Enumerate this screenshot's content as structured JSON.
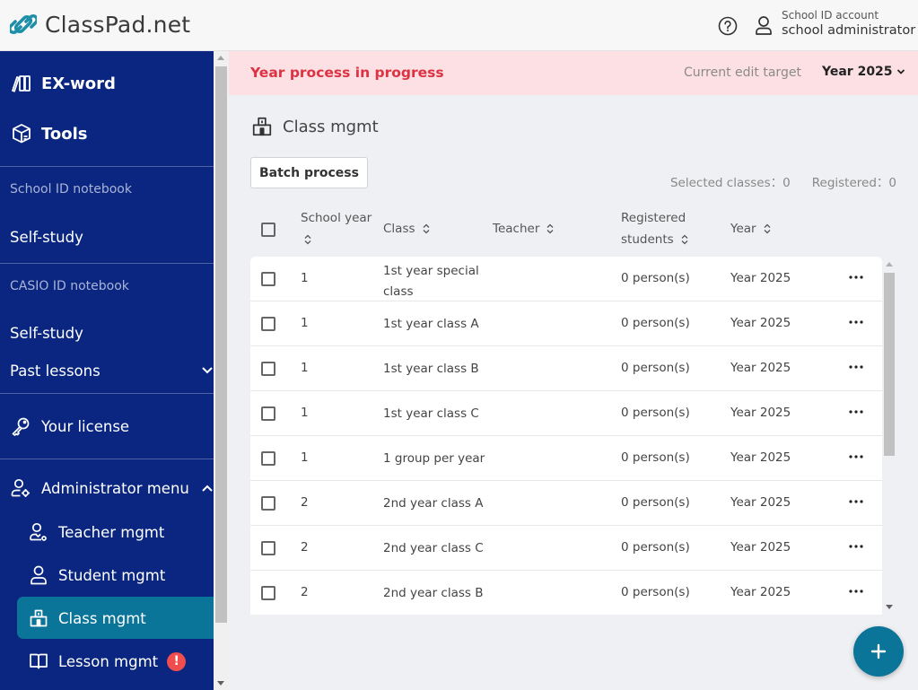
{
  "header": {
    "logo_text": "ClassPad.net",
    "account_type": "School ID account",
    "account_name": "school administrator"
  },
  "sidebar": {
    "exword": "EX-word",
    "tools": "Tools",
    "school_section": "School ID notebook",
    "school_selfstudy": "Self-study",
    "casio_section": "CASIO ID notebook",
    "casio_selfstudy": "Self-study",
    "past_lessons": "Past lessons",
    "license": "Your license",
    "admin_menu": "Administrator menu",
    "admin_items": [
      {
        "label": "Teacher mgmt"
      },
      {
        "label": "Student mgmt"
      },
      {
        "label": "Class mgmt",
        "active": true
      },
      {
        "label": "Lesson mgmt",
        "badge": "!"
      }
    ]
  },
  "banner": {
    "title": "Year process in progress",
    "edit_label": "Current edit target",
    "year": "Year 2025"
  },
  "page": {
    "title": "Class mgmt",
    "batch_button": "Batch process",
    "selected_classes": "Selected classes：0",
    "registered": "Registered：0"
  },
  "table": {
    "headers": {
      "school_year_1": "School year",
      "class": "Class",
      "teacher": "Teacher",
      "registered_1": "Registered",
      "registered_2": "students",
      "year": "Year"
    },
    "rows": [
      {
        "school_year": "1",
        "class": "1st year special class",
        "teacher": "",
        "registered": "0 person(s)",
        "year": "Year 2025"
      },
      {
        "school_year": "1",
        "class": "1st year class A",
        "teacher": "",
        "registered": "0 person(s)",
        "year": "Year 2025"
      },
      {
        "school_year": "1",
        "class": "1st year class B",
        "teacher": "",
        "registered": "0 person(s)",
        "year": "Year 2025"
      },
      {
        "school_year": "1",
        "class": "1st year class C",
        "teacher": "",
        "registered": "0 person(s)",
        "year": "Year 2025"
      },
      {
        "school_year": "1",
        "class": "1 group per year",
        "teacher": "",
        "registered": "0 person(s)",
        "year": "Year 2025"
      },
      {
        "school_year": "2",
        "class": "2nd year class A",
        "teacher": "",
        "registered": "0 person(s)",
        "year": "Year 2025"
      },
      {
        "school_year": "2",
        "class": "2nd year class C",
        "teacher": "",
        "registered": "0 person(s)",
        "year": "Year 2025"
      },
      {
        "school_year": "2",
        "class": "2nd year class B",
        "teacher": "",
        "registered": "0 person(s)",
        "year": "Year 2025"
      }
    ]
  },
  "colors": {
    "sidebar_bg": "#0a2680",
    "accent": "#0a7499",
    "banner_bg": "#fde0e4",
    "banner_text": "#dc3242",
    "badge": "#f04e4e"
  }
}
